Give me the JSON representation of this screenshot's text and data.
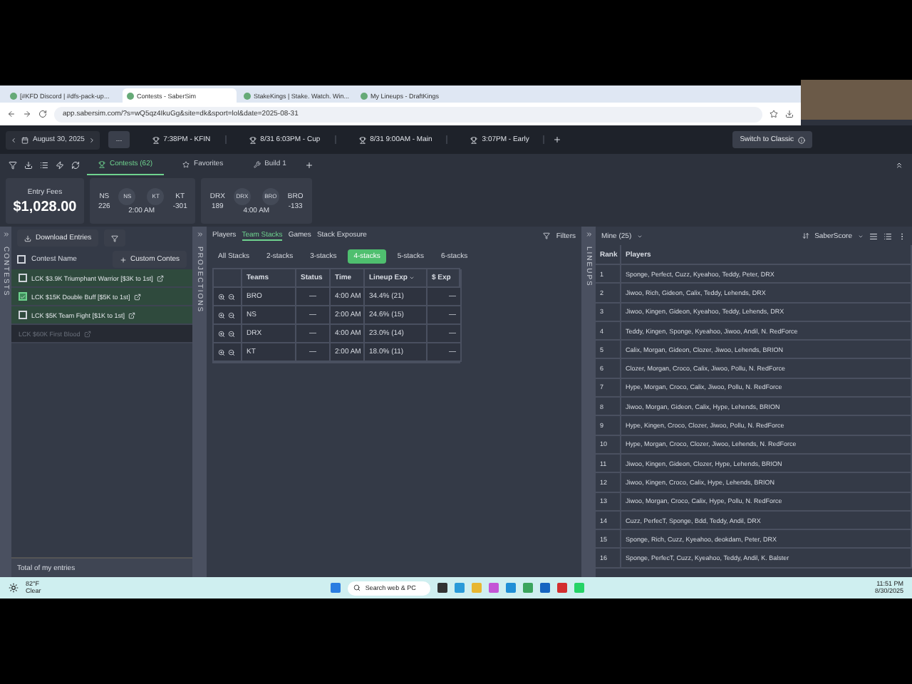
{
  "browser": {
    "tabs": [
      {
        "label": "[#KFD Discord | #dfs-pack-up...",
        "selected": false
      },
      {
        "label": "Contests - SaberSim",
        "selected": true
      },
      {
        "label": "StakeKings | Stake. Watch. Win...",
        "selected": false
      },
      {
        "label": "My Lineups - DraftKings",
        "selected": false
      }
    ],
    "url": "app.sabersim.com/?s=wQ5qz4IkuGg&site=dk&sport=lol&date=2025-08-31"
  },
  "app_header": {
    "date": "August 30, 2025",
    "more": "...",
    "slates": [
      {
        "label": "7:38PM - KFIN",
        "selected": false
      },
      {
        "label": "8/31 6:03PM - Cup",
        "selected": false
      },
      {
        "label": "8/31 9:00AM - Main",
        "selected": false
      },
      {
        "label": "3:07PM - Early",
        "selected": false
      }
    ],
    "switch_button": "Switch to Classic"
  },
  "toolbar": {
    "tabs": [
      {
        "label": "Contests (62)",
        "selected": true,
        "kind": "trophy"
      },
      {
        "label": "Favorites",
        "selected": false,
        "kind": "star"
      },
      {
        "label": "Build 1",
        "selected": false,
        "kind": "build"
      }
    ]
  },
  "entry_fees": {
    "label": "Entry Fees",
    "value": "$1,028.00"
  },
  "games": [
    {
      "away": {
        "team": "NS",
        "odds": "226",
        "logo": "NS"
      },
      "home": {
        "team": "KT",
        "odds": "-301",
        "logo": "KT"
      },
      "time": "2:00 AM"
    },
    {
      "away": {
        "team": "DRX",
        "odds": "189",
        "logo": "DRX"
      },
      "home": {
        "team": "BRO",
        "odds": "-133",
        "logo": "BRO"
      },
      "time": "4:00 AM"
    }
  ],
  "contests_panel": {
    "side_label": "CONTESTS",
    "download_button": "Download Entries",
    "column": "Contest Name",
    "custom_button": "Custom Contes",
    "contests": [
      {
        "name": "LCK $3.9K Triumphant Warrior [$3K to 1st]",
        "checked": false,
        "disabled": false
      },
      {
        "name": "LCK $15K Double Buff [$5K to 1st]",
        "checked": true,
        "disabled": false
      },
      {
        "name": "LCK $5K Team Fight [$1K to 1st]",
        "checked": false,
        "disabled": false
      },
      {
        "name": "LCK $60K First Blood",
        "disabled": true
      }
    ],
    "all_checked": false,
    "footer": "Total of my entries"
  },
  "projections_panel": {
    "side_label": "PROJECTIONS",
    "tabs": [
      {
        "label": "Players",
        "selected": false
      },
      {
        "label": "Team Stacks",
        "selected": true
      },
      {
        "label": "Games",
        "selected": false
      },
      {
        "label": "Stack Exposure",
        "selected": false
      }
    ],
    "filters": "Filters",
    "stack_tabs": [
      {
        "label": "All Stacks",
        "selected": false
      },
      {
        "label": "2-stacks",
        "selected": false
      },
      {
        "label": "3-stacks",
        "selected": false
      },
      {
        "label": "4-stacks",
        "selected": true
      },
      {
        "label": "5-stacks",
        "selected": false
      },
      {
        "label": "6-stacks",
        "selected": false
      }
    ],
    "table": {
      "columns": [
        "Teams",
        "Status",
        "Time",
        "Lineup Exp",
        "$ Exp"
      ],
      "rows": [
        {
          "team": "BRO",
          "status": "—",
          "time": "4:00 AM",
          "lineup_exp": "34.4% (21)",
          "dollar_exp": "—"
        },
        {
          "team": "NS",
          "status": "—",
          "time": "2:00 AM",
          "lineup_exp": "24.6% (15)",
          "dollar_exp": "—"
        },
        {
          "team": "DRX",
          "status": "—",
          "time": "4:00 AM",
          "lineup_exp": "23.0% (14)",
          "dollar_exp": "—"
        },
        {
          "team": "KT",
          "status": "—",
          "time": "2:00 AM",
          "lineup_exp": "18.0% (11)",
          "dollar_exp": "—"
        }
      ]
    }
  },
  "lineups_panel": {
    "side_label": "LINEUPS",
    "filter": "Mine (25)",
    "sort": "SaberScore",
    "columns": [
      "Rank",
      "Players"
    ],
    "rows": [
      {
        "rank": "1",
        "players": "Sponge, Perfect, Cuzz, Kyeahoo, Teddy, Peter, DRX"
      },
      {
        "rank": "2",
        "players": "Jiwoo, Rich, Gideon, Calix, Teddy, Lehends, DRX"
      },
      {
        "rank": "3",
        "players": "Jiwoo, Kingen, Gideon, Kyeahoo, Teddy, Lehends, DRX"
      },
      {
        "rank": "4",
        "players": "Teddy, Kingen, Sponge, Kyeahoo, Jiwoo, Andil, N. RedForce"
      },
      {
        "rank": "5",
        "players": "Calix, Morgan, Gideon, Clozer, Jiwoo, Lehends, BRION"
      },
      {
        "rank": "6",
        "players": "Clozer, Morgan, Croco, Calix, Jiwoo, Pollu, N. RedForce"
      },
      {
        "rank": "7",
        "players": "Hype, Morgan, Croco, Calix, Jiwoo, Pollu, N. RedForce"
      },
      {
        "rank": "8",
        "players": "Jiwoo, Morgan, Gideon, Calix, Hype, Lehends, BRION"
      },
      {
        "rank": "9",
        "players": "Hype, Kingen, Croco, Clozer, Jiwoo, Pollu, N. RedForce"
      },
      {
        "rank": "10",
        "players": "Hype, Morgan, Croco, Clozer, Jiwoo, Lehends, N. RedForce"
      },
      {
        "rank": "11",
        "players": "Jiwoo, Kingen, Gideon, Clozer, Hype, Lehends, BRION"
      },
      {
        "rank": "12",
        "players": "Jiwoo, Kingen, Croco, Calix, Hype, Lehends, BRION"
      },
      {
        "rank": "13",
        "players": "Jiwoo, Morgan, Croco, Calix, Hype, Pollu, N. RedForce"
      },
      {
        "rank": "14",
        "players": "Cuzz, PerfecT, Sponge, Bdd, Teddy, Andil, DRX"
      },
      {
        "rank": "15",
        "players": "Sponge, Rich, Cuzz, Kyeahoo, deokdam, Peter, DRX"
      },
      {
        "rank": "16",
        "players": "Sponge, PerfecT, Cuzz, Kyeahoo, Teddy, Andil, K. Balster"
      }
    ]
  },
  "taskbar": {
    "weather_temp": "82°F",
    "weather_text": "Clear",
    "search": "Search web & PC",
    "time": "11:51 PM",
    "date": "8/30/2025"
  }
}
